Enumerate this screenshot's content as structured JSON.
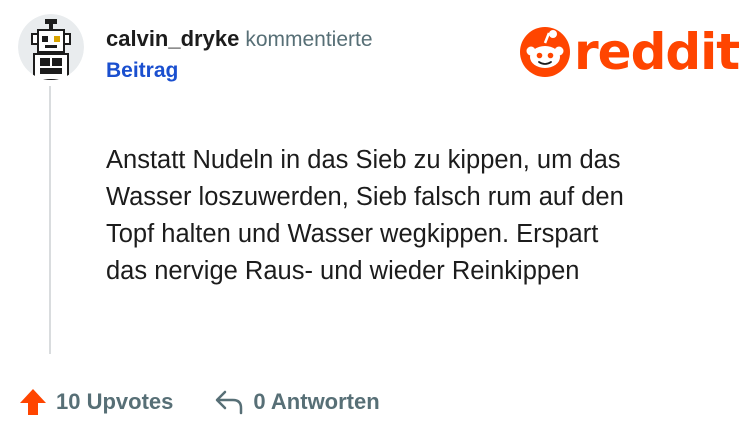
{
  "comment": {
    "username": "calvin_dryke",
    "action": "kommentierte",
    "post_link": "Beitrag",
    "avatar_icon": "robot-avatar-icon",
    "lines": [
      "Anstatt Nudeln in das Sieb zu kippen, um das",
      "Wasser loszuwerden, Sieb falsch rum auf den",
      "Topf halten und Wasser wegkippen. Erspart",
      "das nervige Raus- und wieder Reinkippen"
    ]
  },
  "logo": {
    "word": "reddit",
    "icon": "reddit-snoo-icon",
    "color": "#ff4500"
  },
  "footer": {
    "upvotes_label": "10 Upvotes",
    "upvote_icon": "upvote-arrow-icon",
    "upvote_color": "#ff4500",
    "replies_label": "0 Antworten",
    "reply_icon": "reply-arrow-icon"
  },
  "colors": {
    "link": "#1a4fcf",
    "muted": "#576f76",
    "text": "#1c1c1c"
  }
}
